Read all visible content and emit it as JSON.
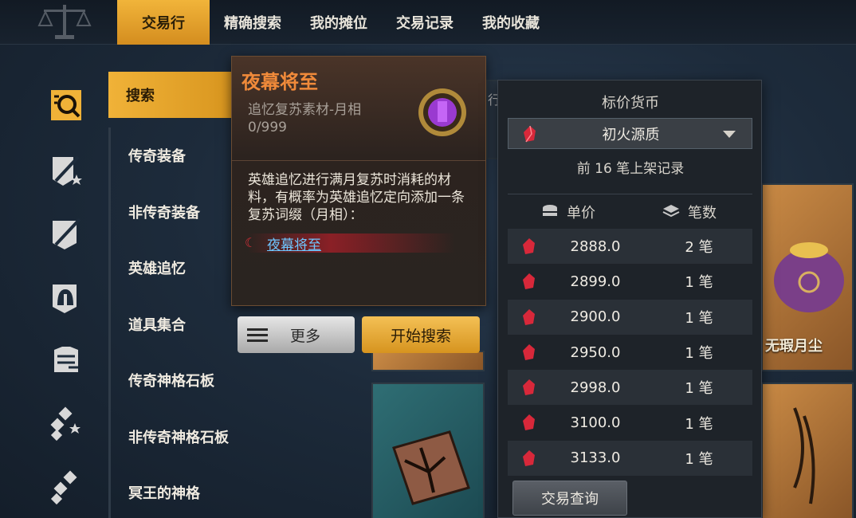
{
  "tabs": [
    "交易行",
    "精确搜索",
    "我的摊位",
    "交易记录",
    "我的收藏"
  ],
  "categories": [
    "搜索",
    "传奇装备",
    "非传奇装备",
    "英雄追忆",
    "道具集合",
    "传奇神格石板",
    "非传奇神格石板",
    "冥王的神格"
  ],
  "rail_icons": [
    "search-category-icon",
    "legendary-weapon-icon",
    "weapon-icon",
    "helmet-icon",
    "armor-icon",
    "legendary-sigil-icon",
    "sigil-icon"
  ],
  "tooltip": {
    "title": "夜幕将至",
    "subtitle": "追忆复苏素材-月相",
    "count": "0/999",
    "description": "英雄追忆进行满月复苏时消耗的材料，有概率为英雄追忆定向添加一条复苏词缀（月相）：",
    "link": "夜幕将至"
  },
  "buttons": {
    "more": "更多",
    "search": "开始搜索"
  },
  "currency_panel": {
    "title": "标价货币",
    "selected_currency": "初火源质",
    "records": "前 16 笔上架记录",
    "col_price": "单价",
    "col_count": "笔数",
    "rows": [
      {
        "price": "2888.0",
        "count": "2 笔"
      },
      {
        "price": "2899.0",
        "count": "1 笔"
      },
      {
        "price": "2900.0",
        "count": "1 笔"
      },
      {
        "price": "2950.0",
        "count": "1 笔"
      },
      {
        "price": "2998.0",
        "count": "1 笔"
      },
      {
        "price": "3100.0",
        "count": "1 笔"
      },
      {
        "price": "3133.0",
        "count": "1 笔"
      }
    ],
    "query_button": "交易查询"
  },
  "item_label": "无瑕月尘",
  "partial_text": "行",
  "colors": {
    "accent": "#f0b238",
    "title": "#f08a3a",
    "link": "#6ec6ff",
    "gem": "#d8283a"
  }
}
